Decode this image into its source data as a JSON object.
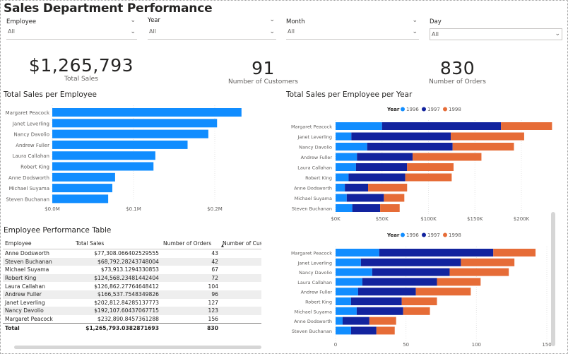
{
  "title": "Sales Department Performance",
  "slicers": [
    {
      "label": "Employee",
      "value": "All"
    },
    {
      "label": "Year",
      "value": "All"
    },
    {
      "label": "Month",
      "value": "All"
    },
    {
      "label": "Day",
      "value": "All"
    }
  ],
  "kpis": [
    {
      "value": "$1,265,793",
      "label": "Total Sales"
    },
    {
      "value": "91",
      "label": "Number of Customers"
    },
    {
      "value": "830",
      "label": "Number of Orders"
    }
  ],
  "colors": {
    "y1996": "#118dff",
    "y1997": "#12239e",
    "y1998": "#e66c37",
    "bar": "#118dff"
  },
  "chart_data": [
    {
      "type": "bar",
      "title": "Total Sales per Employee",
      "categories": [
        "Margaret Peacock",
        "Janet Leverling",
        "Nancy Davolio",
        "Andrew Fuller",
        "Laura Callahan",
        "Robert King",
        "Anne Dodsworth",
        "Michael Suyama",
        "Steven Buchanan"
      ],
      "values": [
        232890.85,
        202812.84,
        192107.6,
        166537.75,
        126862.28,
        124568.23,
        77308.07,
        73913.13,
        68792.28
      ],
      "x_ticks": [
        "$0.0M",
        "$0.1M",
        "$0.2M"
      ],
      "xlim": [
        0,
        0.2
      ]
    },
    {
      "type": "bar",
      "title": "Total Sales per Employee per Year",
      "legend_title": "Year",
      "categories": [
        "Margaret Peacock",
        "Janet Leverling",
        "Nancy Davolio",
        "Andrew Fuller",
        "Laura Callahan",
        "Robert King",
        "Anne Dodsworth",
        "Michael Suyama",
        "Steven Buchanan"
      ],
      "series": [
        {
          "name": "1996",
          "values": [
            50000,
            17000,
            34000,
            23000,
            22000,
            14000,
            10000,
            12000,
            18000
          ]
        },
        {
          "name": "1997",
          "values": [
            128000,
            107000,
            92000,
            60000,
            55000,
            61000,
            25000,
            40000,
            30000
          ]
        },
        {
          "name": "1998",
          "values": [
            55000,
            79000,
            66000,
            74000,
            50000,
            50000,
            42000,
            22000,
            21000
          ]
        }
      ],
      "x_ticks": [
        "$0K",
        "$50K",
        "$100K",
        "$150K",
        "$200K"
      ],
      "xlim": [
        0,
        200000
      ]
    },
    {
      "type": "bar",
      "legend_title": "Year",
      "categories": [
        "Margaret Peacock",
        "Janet Leverling",
        "Nancy Davolio",
        "Laura Callahan",
        "Andrew Fuller",
        "Robert King",
        "Michael Suyama",
        "Anne Dodsworth",
        "Steven Buchanan"
      ],
      "series": [
        {
          "name": "1996",
          "values": [
            31,
            18,
            26,
            19,
            16,
            11,
            15,
            5,
            11
          ]
        },
        {
          "name": "1997",
          "values": [
            81,
            71,
            55,
            53,
            41,
            36,
            33,
            19,
            18
          ]
        },
        {
          "name": "1998",
          "values": [
            30,
            38,
            42,
            31,
            39,
            25,
            19,
            19,
            13
          ]
        }
      ],
      "x_ticks": [
        "0",
        "50",
        "100",
        "150"
      ],
      "xlim": [
        0,
        150
      ]
    }
  ],
  "table": {
    "title": "Employee Performance Table",
    "columns": [
      "Employee",
      "Total Sales",
      "Number of Orders",
      "Number of Cust"
    ],
    "rows": [
      [
        "Anne Dodsworth",
        "$77,308.066402529555",
        "43"
      ],
      [
        "Steven Buchanan",
        "$68,792.28243748004",
        "42"
      ],
      [
        "Michael Suyama",
        "$73,913.1294330853",
        "67"
      ],
      [
        "Robert King",
        "$124,568.23481442404",
        "72"
      ],
      [
        "Laura Callahan",
        "$126,862.27764648412",
        "104"
      ],
      [
        "Andrew Fuller",
        "$166,537.7548349826",
        "96"
      ],
      [
        "Janet Leverling",
        "$202,812.84285137773",
        "127"
      ],
      [
        "Nancy Davolio",
        "$192,107.60437067715",
        "123"
      ],
      [
        "Margaret Peacock",
        "$232,890.8457361288",
        "156"
      ]
    ],
    "total": [
      "Total",
      "$1,265,793.0382871693",
      "830"
    ]
  }
}
